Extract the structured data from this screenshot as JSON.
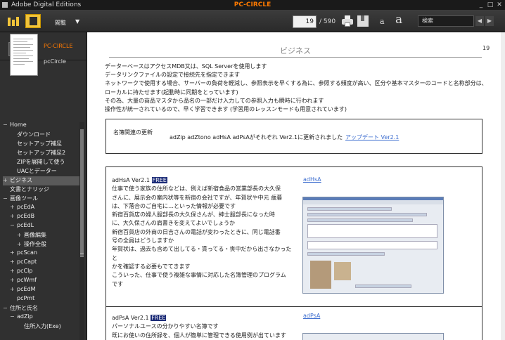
{
  "titlebar": {
    "app_name": "Adobe Digital Editions",
    "doc_title": "PC-CIRCLE",
    "min": "_",
    "max": "□",
    "close": "✕"
  },
  "toolbar": {
    "view_label": "閲覧",
    "view_caret": "▼",
    "current_page": "19",
    "total_pages": "/ 590",
    "font_small": "a",
    "font_large": "a",
    "search_placeholder": "検索",
    "prev": "◀",
    "next": "▶"
  },
  "book": {
    "title": "PC-CIRCLE",
    "subtitle": "pcCircle"
  },
  "toc": [
    {
      "label": "Home",
      "toggle": "−",
      "indent": 0
    },
    {
      "label": "ダウンロード",
      "toggle": "",
      "indent": 1
    },
    {
      "label": "セットアップ補足",
      "toggle": "",
      "indent": 1
    },
    {
      "label": "セットアップ補足2",
      "toggle": "",
      "indent": 1
    },
    {
      "label": "ZIPを展開して使う",
      "toggle": "",
      "indent": 1
    },
    {
      "label": "UACとデーター",
      "toggle": "",
      "indent": 1
    },
    {
      "label": "ビジネス",
      "toggle": "+",
      "indent": 0,
      "selected": true
    },
    {
      "label": "文書とナリッジ",
      "toggle": "",
      "indent": 0
    },
    {
      "label": "画像ツール",
      "toggle": "−",
      "indent": 0
    },
    {
      "label": "pcEdA",
      "toggle": "+",
      "indent": 1
    },
    {
      "label": "pcEdB",
      "toggle": "+",
      "indent": 1
    },
    {
      "label": "pcEdL",
      "toggle": "−",
      "indent": 1
    },
    {
      "label": "画像編集",
      "toggle": "+",
      "indent": 2
    },
    {
      "label": "操作全般",
      "toggle": "+",
      "indent": 2
    },
    {
      "label": "pcScan",
      "toggle": "+",
      "indent": 1
    },
    {
      "label": "pcCapt",
      "toggle": "+",
      "indent": 1
    },
    {
      "label": "pcClp",
      "toggle": "+",
      "indent": 1
    },
    {
      "label": "pcWmf",
      "toggle": "+",
      "indent": 1
    },
    {
      "label": "pcEdM",
      "toggle": "+",
      "indent": 1
    },
    {
      "label": "pcPmt",
      "toggle": "",
      "indent": 1
    },
    {
      "label": "住所と氏名",
      "toggle": "−",
      "indent": 0
    },
    {
      "label": "adZip",
      "toggle": "−",
      "indent": 1
    },
    {
      "label": "住所入力(Exe)",
      "toggle": "",
      "indent": 2
    }
  ],
  "page": {
    "number": "19",
    "section_title": "ビジネス",
    "intro": [
      "データーベースはアクセスMDB又は、SQL Serverを使用します",
      "データリンクファイルの設定で接続先を指定できます",
      "ネットワークで使用する場合、サーバーの負荷を軽減し、参照表示を早くする為に、参照する頻度が高い、区分や基本マスターのコードと名称部分は、",
      "ローカルに持たせます(起動時に同期をとっています)",
      "その為、大量の商品マスタから品名の一部だけ入力しての参照入力も瞬時に行われます",
      "操作性が統一されているので、早く学習できます (学習用のレッスンモードも用意されています)"
    ],
    "update_box": {
      "label": "名簿関連の更新",
      "text": "adZip adZtono adHsA adPsAがそれぞれ Ver2.1に更新されました",
      "link": "アップデート Ver2.1"
    },
    "product1": {
      "name": "adHsA Ver2.1",
      "badge": "FREE",
      "link": "adHsA",
      "lines": [
        "仕事で使う家族の住所などは、例えば新宿食品の営業部長の大久保",
        "さんに、展示会の案内状等を新宿の会社ですが、年賀状や中元 歳暮",
        "は、下落合のご自宅に…といった情報が必要です",
        "新宿百貨店の婦人服部長の大久保さんが、紳士服部長になった時",
        "に、大久保さんの肩書きを変えてよいでしょうか",
        "新宿百貨店の外商の日吉さんの電話が変わったときに、同じ電話番",
        "号の全員はどうしますか",
        "年賀状は、過去も含めて出してる・貰ってる・喪中だから出さなかったと",
        "かを確認する必要もでてきます",
        "こういった、仕事で使う複雑な事情に対応した名簿管理のプログラム",
        "です"
      ]
    },
    "product2": {
      "name": "adPsA Ver2.1",
      "badge": "FREE",
      "link": "adPsA",
      "lines": [
        "パーソナルユースの分かりやすい名簿です",
        "既にお使いの住所録を、個人が簡単に管理できる使用例が出ています"
      ]
    }
  }
}
